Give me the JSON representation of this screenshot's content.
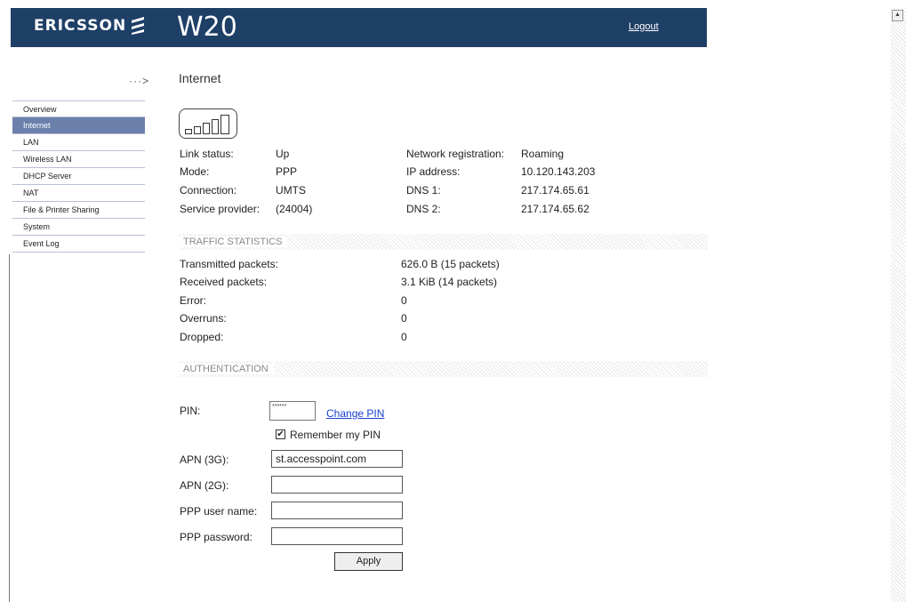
{
  "header": {
    "brand": "ERICSSON",
    "product": "W20",
    "logout": "Logout"
  },
  "nav": {
    "arrow": "···>",
    "items": [
      "Overview",
      "Internet",
      "LAN",
      "Wireless LAN",
      "DHCP Server",
      "NAT",
      "File & Printer Sharing",
      "System",
      "Event Log"
    ],
    "active": "Internet"
  },
  "page": {
    "title": "Internet"
  },
  "status": {
    "link_status_label": "Link status:",
    "link_status": "Up",
    "mode_label": "Mode:",
    "mode": "PPP",
    "connection_label": "Connection:",
    "connection": "UMTS",
    "service_provider_label": "Service provider:",
    "service_provider": "(24004)",
    "network_registration_label": "Network registration:",
    "network_registration": "Roaming",
    "ip_address_label": "IP address:",
    "ip_address": "10.120.143.203",
    "dns1_label": "DNS 1:",
    "dns1": "217.174.65.61",
    "dns2_label": "DNS 2:",
    "dns2": "217.174.65.62"
  },
  "traffic": {
    "heading": "TRAFFIC STATISTICS",
    "rows": [
      {
        "label": "Transmitted packets:",
        "value": "626.0 B (15 packets)"
      },
      {
        "label": "Received packets:",
        "value": "3.1 KiB (14 packets)"
      },
      {
        "label": "Error:",
        "value": "0"
      },
      {
        "label": "Overruns:",
        "value": "0"
      },
      {
        "label": "Dropped:",
        "value": "0"
      }
    ]
  },
  "auth": {
    "heading": "AUTHENTICATION",
    "pin_label": "PIN:",
    "pin_value": "******",
    "change_pin": "Change PIN",
    "remember_pin": "Remember my PIN",
    "remember_checked": true,
    "apn3g_label": "APN (3G):",
    "apn3g_value": "st.accesspoint.com",
    "apn2g_label": "APN (2G):",
    "apn2g_value": "",
    "ppp_user_label": "PPP user name:",
    "ppp_user_value": "",
    "ppp_pass_label": "PPP password:",
    "ppp_pass_value": "",
    "apply": "Apply"
  },
  "icons": {
    "signal": "signal-strength-icon",
    "check": "✔",
    "scroll_up": "▲"
  },
  "colors": {
    "header_bg": "#1e3f66",
    "menu_active": "#6b81ac",
    "link": "#1a3ecc"
  }
}
